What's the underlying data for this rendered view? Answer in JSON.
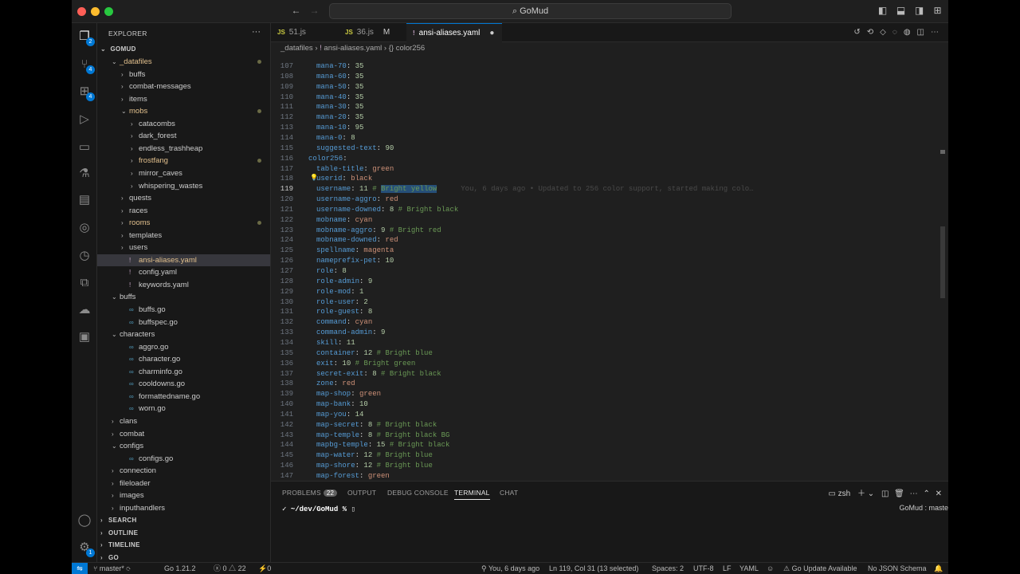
{
  "titlebar": {
    "search_text": "GoMud",
    "search_icon": "search-icon"
  },
  "activity": {
    "items": [
      {
        "name": "explorer",
        "glyph": "❐",
        "badge": "2"
      },
      {
        "name": "source-control",
        "glyph": "⑂",
        "badge": "4"
      },
      {
        "name": "extensions",
        "glyph": "⊞",
        "badge": "4"
      },
      {
        "name": "run-debug",
        "glyph": "▷",
        "badge": ""
      },
      {
        "name": "remote-explorer",
        "glyph": "▭",
        "badge": ""
      },
      {
        "name": "testing",
        "glyph": "⚗",
        "badge": ""
      },
      {
        "name": "folders",
        "glyph": "▤",
        "badge": ""
      },
      {
        "name": "git-graph",
        "glyph": "◎",
        "badge": ""
      },
      {
        "name": "timeline",
        "glyph": "◷",
        "badge": ""
      },
      {
        "name": "containers",
        "glyph": "⧉",
        "badge": ""
      },
      {
        "name": "docker",
        "glyph": "☁",
        "badge": ""
      },
      {
        "name": "terminal",
        "glyph": "▣",
        "badge": ""
      }
    ],
    "account_glyph": "◯",
    "manage_glyph": "⚙",
    "manage_badge": "1"
  },
  "sidebar": {
    "title": "EXPLORER",
    "more": "···",
    "root": "GOMUD",
    "tree": [
      {
        "label": "_datafiles",
        "depth": 1,
        "kind": "folder-open",
        "color": "#e2c08d",
        "dot": true
      },
      {
        "label": "buffs",
        "depth": 2,
        "kind": "folder",
        "color": "#cccccc",
        "dot": false
      },
      {
        "label": "combat-messages",
        "depth": 2,
        "kind": "folder",
        "color": "#cccccc",
        "dot": false
      },
      {
        "label": "items",
        "depth": 2,
        "kind": "folder",
        "color": "#cccccc",
        "dot": false
      },
      {
        "label": "mobs",
        "depth": 2,
        "kind": "folder-open",
        "color": "#e2c08d",
        "dot": true
      },
      {
        "label": "catacombs",
        "depth": 3,
        "kind": "folder",
        "color": "#cccccc",
        "dot": false
      },
      {
        "label": "dark_forest",
        "depth": 3,
        "kind": "folder",
        "color": "#cccccc",
        "dot": false
      },
      {
        "label": "endless_trashheap",
        "depth": 3,
        "kind": "folder",
        "color": "#cccccc",
        "dot": false
      },
      {
        "label": "frostfang",
        "depth": 3,
        "kind": "folder",
        "color": "#e2c08d",
        "dot": true
      },
      {
        "label": "mirror_caves",
        "depth": 3,
        "kind": "folder",
        "color": "#cccccc",
        "dot": false
      },
      {
        "label": "whispering_wastes",
        "depth": 3,
        "kind": "folder",
        "color": "#cccccc",
        "dot": false
      },
      {
        "label": "quests",
        "depth": 2,
        "kind": "folder",
        "color": "#cccccc",
        "dot": false
      },
      {
        "label": "races",
        "depth": 2,
        "kind": "folder",
        "color": "#cccccc",
        "dot": false
      },
      {
        "label": "rooms",
        "depth": 2,
        "kind": "folder",
        "color": "#e2c08d",
        "dot": true
      },
      {
        "label": "templates",
        "depth": 2,
        "kind": "folder",
        "color": "#cccccc",
        "dot": false
      },
      {
        "label": "users",
        "depth": 2,
        "kind": "folder",
        "color": "#cccccc",
        "dot": false
      },
      {
        "label": "ansi-aliases.yaml",
        "depth": 2,
        "kind": "yaml",
        "color": "#e2c08d",
        "dot": false,
        "selected": true
      },
      {
        "label": "config.yaml",
        "depth": 2,
        "kind": "yaml",
        "color": "#cccccc",
        "dot": false
      },
      {
        "label": "keywords.yaml",
        "depth": 2,
        "kind": "yaml",
        "color": "#cccccc",
        "dot": false
      },
      {
        "label": "buffs",
        "depth": 1,
        "kind": "folder-open",
        "color": "#cccccc",
        "dot": false
      },
      {
        "label": "buffs.go",
        "depth": 2,
        "kind": "go",
        "color": "#cccccc",
        "dot": false
      },
      {
        "label": "buffspec.go",
        "depth": 2,
        "kind": "go",
        "color": "#cccccc",
        "dot": false
      },
      {
        "label": "characters",
        "depth": 1,
        "kind": "folder-open",
        "color": "#cccccc",
        "dot": false
      },
      {
        "label": "aggro.go",
        "depth": 2,
        "kind": "go",
        "color": "#cccccc",
        "dot": false
      },
      {
        "label": "character.go",
        "depth": 2,
        "kind": "go",
        "color": "#cccccc",
        "dot": false
      },
      {
        "label": "charminfo.go",
        "depth": 2,
        "kind": "go",
        "color": "#cccccc",
        "dot": false
      },
      {
        "label": "cooldowns.go",
        "depth": 2,
        "kind": "go",
        "color": "#cccccc",
        "dot": false
      },
      {
        "label": "formattedname.go",
        "depth": 2,
        "kind": "go",
        "color": "#cccccc",
        "dot": false
      },
      {
        "label": "worn.go",
        "depth": 2,
        "kind": "go",
        "color": "#cccccc",
        "dot": false
      },
      {
        "label": "clans",
        "depth": 1,
        "kind": "folder",
        "color": "#cccccc",
        "dot": false
      },
      {
        "label": "combat",
        "depth": 1,
        "kind": "folder",
        "color": "#cccccc",
        "dot": false
      },
      {
        "label": "configs",
        "depth": 1,
        "kind": "folder-open",
        "color": "#cccccc",
        "dot": false
      },
      {
        "label": "configs.go",
        "depth": 2,
        "kind": "go",
        "color": "#cccccc",
        "dot": false
      },
      {
        "label": "connection",
        "depth": 1,
        "kind": "folder",
        "color": "#cccccc",
        "dot": false
      },
      {
        "label": "fileloader",
        "depth": 1,
        "kind": "folder",
        "color": "#cccccc",
        "dot": false
      },
      {
        "label": "images",
        "depth": 1,
        "kind": "folder",
        "color": "#cccccc",
        "dot": false
      },
      {
        "label": "inputhandlers",
        "depth": 1,
        "kind": "folder",
        "color": "#cccccc",
        "dot": false
      }
    ],
    "sections": [
      "SEARCH",
      "OUTLINE",
      "TIMELINE",
      "GO"
    ]
  },
  "tabs": [
    {
      "label": "51.js",
      "icon": "JS",
      "icon_color": "#cbcb41",
      "modified": "",
      "active": false
    },
    {
      "label": "36.js",
      "icon": "JS",
      "icon_color": "#cbcb41",
      "modified": "M",
      "active": false
    },
    {
      "label": "ansi-aliases.yaml",
      "icon": "!",
      "icon_color": "#c5a5c5",
      "modified": "●",
      "active": true
    }
  ],
  "breadcrumb": {
    "folder": "_datafiles",
    "sep": "›",
    "file": "ansi-aliases.yaml",
    "symbol": "{} color256"
  },
  "code": {
    "lines": [
      {
        "n": "107",
        "key": "mana-70",
        "val": "35",
        "vt": "n",
        "indent": 2,
        "cmt": ""
      },
      {
        "n": "108",
        "key": "mana-60",
        "val": "35",
        "vt": "n",
        "indent": 2,
        "cmt": ""
      },
      {
        "n": "109",
        "key": "mana-50",
        "val": "35",
        "vt": "n",
        "indent": 2,
        "cmt": ""
      },
      {
        "n": "110",
        "key": "mana-40",
        "val": "35",
        "vt": "n",
        "indent": 2,
        "cmt": ""
      },
      {
        "n": "111",
        "key": "mana-30",
        "val": "35",
        "vt": "n",
        "indent": 2,
        "cmt": ""
      },
      {
        "n": "112",
        "key": "mana-20",
        "val": "35",
        "vt": "n",
        "indent": 2,
        "cmt": ""
      },
      {
        "n": "113",
        "key": "mana-10",
        "val": "95",
        "vt": "n",
        "indent": 2,
        "cmt": ""
      },
      {
        "n": "114",
        "key": "mana-0",
        "val": "8",
        "vt": "n",
        "indent": 2,
        "cmt": ""
      },
      {
        "n": "115",
        "key": "suggested-text",
        "val": "90",
        "vt": "n",
        "indent": 2,
        "cmt": ""
      },
      {
        "n": "116",
        "key": "color256",
        "val": "",
        "vt": "n",
        "indent": 0,
        "cmt": ""
      },
      {
        "n": "117",
        "key": "table-title",
        "val": "green",
        "vt": "s",
        "indent": 2,
        "cmt": ""
      },
      {
        "n": "118",
        "key": "userid",
        "val": "black",
        "vt": "s",
        "indent": 2,
        "cmt": "",
        "bulb": true
      },
      {
        "n": "119",
        "key": "username",
        "val": "11",
        "vt": "n",
        "indent": 2,
        "cmt": "# ",
        "sel": "Bright yellow",
        "blame": "You, 6 days ago • Updated to 256 color support, started making colo…",
        "current": true
      },
      {
        "n": "120",
        "key": "username-aggro",
        "val": "red",
        "vt": "s",
        "indent": 2,
        "cmt": ""
      },
      {
        "n": "121",
        "key": "username-downed",
        "val": "8",
        "vt": "n",
        "indent": 2,
        "cmt": "# Bright black"
      },
      {
        "n": "122",
        "key": "mobname",
        "val": "cyan",
        "vt": "s",
        "indent": 2,
        "cmt": ""
      },
      {
        "n": "123",
        "key": "mobname-aggro",
        "val": "9",
        "vt": "n",
        "indent": 2,
        "cmt": "# Bright red"
      },
      {
        "n": "124",
        "key": "mobname-downed",
        "val": "red",
        "vt": "s",
        "indent": 2,
        "cmt": ""
      },
      {
        "n": "125",
        "key": "spellname",
        "val": "magenta",
        "vt": "s",
        "indent": 2,
        "cmt": ""
      },
      {
        "n": "126",
        "key": "nameprefix-pet",
        "val": "10",
        "vt": "n",
        "indent": 2,
        "cmt": ""
      },
      {
        "n": "127",
        "key": "role",
        "val": "8",
        "vt": "n",
        "indent": 2,
        "cmt": ""
      },
      {
        "n": "128",
        "key": "role-admin",
        "val": "9",
        "vt": "n",
        "indent": 2,
        "cmt": ""
      },
      {
        "n": "129",
        "key": "role-mod",
        "val": "1",
        "vt": "n",
        "indent": 2,
        "cmt": ""
      },
      {
        "n": "130",
        "key": "role-user",
        "val": "2",
        "vt": "n",
        "indent": 2,
        "cmt": ""
      },
      {
        "n": "131",
        "key": "role-guest",
        "val": "8",
        "vt": "n",
        "indent": 2,
        "cmt": ""
      },
      {
        "n": "132",
        "key": "command",
        "val": "cyan",
        "vt": "s",
        "indent": 2,
        "cmt": ""
      },
      {
        "n": "133",
        "key": "command-admin",
        "val": "9",
        "vt": "n",
        "indent": 2,
        "cmt": ""
      },
      {
        "n": "134",
        "key": "skill",
        "val": "11",
        "vt": "n",
        "indent": 2,
        "cmt": ""
      },
      {
        "n": "135",
        "key": "container",
        "val": "12",
        "vt": "n",
        "indent": 2,
        "cmt": "# Bright blue"
      },
      {
        "n": "136",
        "key": "exit",
        "val": "10",
        "vt": "n",
        "indent": 2,
        "cmt": "# Bright green"
      },
      {
        "n": "137",
        "key": "secret-exit",
        "val": "8",
        "vt": "n",
        "indent": 2,
        "cmt": "# Bright black"
      },
      {
        "n": "138",
        "key": "zone",
        "val": "red",
        "vt": "s",
        "indent": 2,
        "cmt": ""
      },
      {
        "n": "139",
        "key": "map-shop",
        "val": "green",
        "vt": "s",
        "indent": 2,
        "cmt": ""
      },
      {
        "n": "140",
        "key": "map-bank",
        "val": "10",
        "vt": "n",
        "indent": 2,
        "cmt": ""
      },
      {
        "n": "141",
        "key": "map-you",
        "val": "14",
        "vt": "n",
        "indent": 2,
        "cmt": ""
      },
      {
        "n": "142",
        "key": "map-secret",
        "val": "8",
        "vt": "n",
        "indent": 2,
        "cmt": "# Bright black"
      },
      {
        "n": "143",
        "key": "map-temple",
        "val": "8",
        "vt": "n",
        "indent": 2,
        "cmt": "# Bright black BG"
      },
      {
        "n": "144",
        "key": "mapbg-temple",
        "val": "15",
        "vt": "n",
        "indent": 2,
        "cmt": "# Bright black"
      },
      {
        "n": "145",
        "key": "map-water",
        "val": "12",
        "vt": "n",
        "indent": 2,
        "cmt": "# Bright blue"
      },
      {
        "n": "146",
        "key": "map-shore",
        "val": "12",
        "vt": "n",
        "indent": 2,
        "cmt": "# Bright blue"
      },
      {
        "n": "147",
        "key": "map-forest",
        "val": "green",
        "vt": "s",
        "indent": 2,
        "cmt": ""
      }
    ]
  },
  "panel": {
    "tabs": [
      {
        "label": "PROBLEMS",
        "badge": "22"
      },
      {
        "label": "OUTPUT",
        "badge": ""
      },
      {
        "label": "DEBUG CONSOLE",
        "badge": ""
      },
      {
        "label": "TERMINAL",
        "badge": "",
        "active": true
      },
      {
        "label": "CHAT",
        "badge": ""
      }
    ],
    "shell": "zsh",
    "prompt_check": "✓",
    "prompt": "~/dev/GoMud % ",
    "cursor": "▯",
    "terminal_label": "GoMud : maste"
  },
  "status": {
    "remote": "⇋",
    "branch": "master*",
    "go_version": "Go 1.21.2",
    "errors": "0",
    "warnings": "22",
    "ports": "0",
    "blame": "You, 6 days ago",
    "cursor_pos": "Ln 119, Col 31 (13 selected)",
    "spaces": "Spaces: 2",
    "encoding": "UTF-8",
    "eol": "LF",
    "language": "YAML",
    "go_update": "Go Update Available",
    "schema": "No JSON Schema"
  },
  "colors": {
    "accent": "#0078d4",
    "key": "#569cd6",
    "number": "#b5cea8",
    "string": "#ce9178",
    "comment": "#6a9955"
  }
}
